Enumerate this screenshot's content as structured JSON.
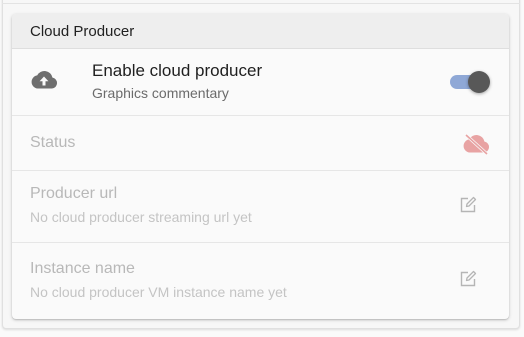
{
  "card": {
    "title": "Cloud Producer"
  },
  "enable": {
    "icon": "cloud-upload-icon",
    "title": "Enable cloud producer",
    "subtitle": "Graphics commentary",
    "toggle_on": true
  },
  "status": {
    "label": "Status",
    "icon": "cloud-off-icon",
    "icon_color": "#e8a3a3"
  },
  "producer_url": {
    "label": "Producer url",
    "value": "No cloud producer streaming url yet",
    "icon": "edit-icon"
  },
  "instance_name": {
    "label": "Instance name",
    "value": "No cloud producer VM instance name yet",
    "icon": "edit-icon"
  },
  "colors": {
    "toggle_track": "#8fa8d6",
    "toggle_thumb": "#585858",
    "disabled_text": "#b8b8b8"
  }
}
